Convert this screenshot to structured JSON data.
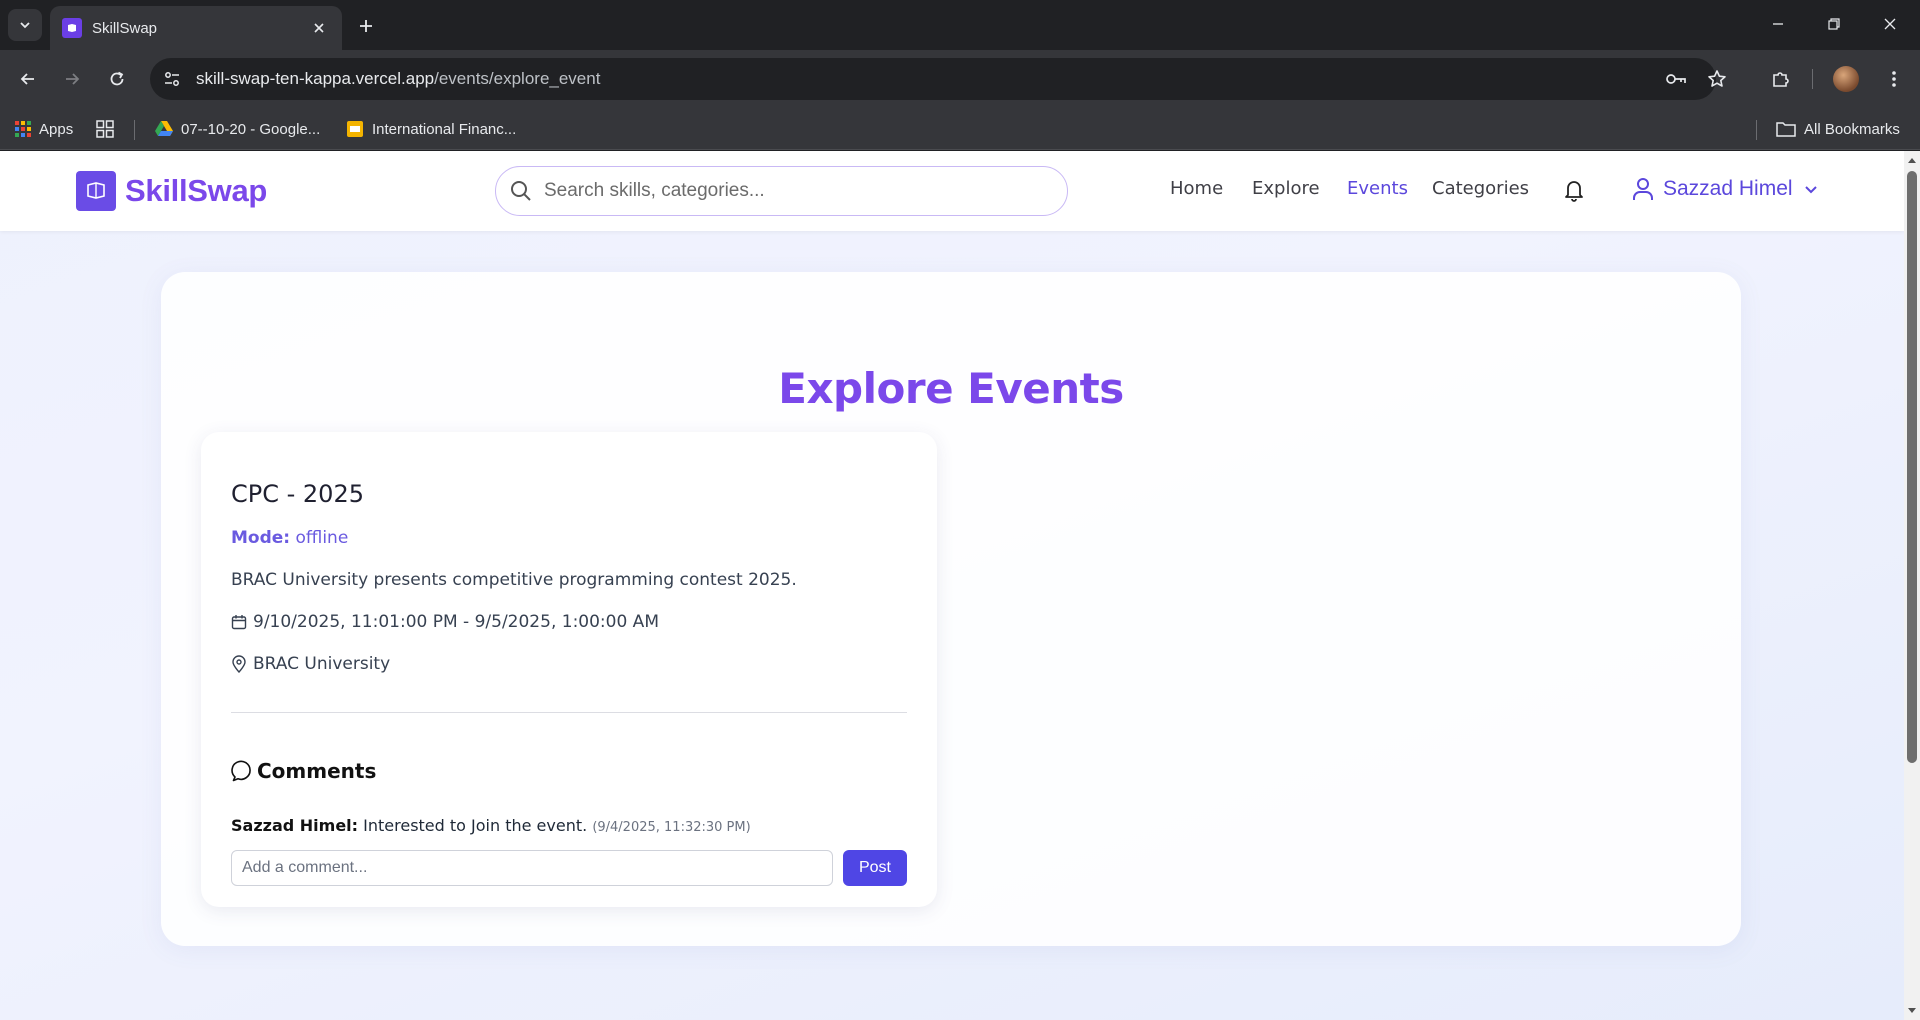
{
  "browser": {
    "tab_title": "SkillSwap",
    "url_host": "skill-swap-ten-kappa.vercel.app",
    "url_path": "/events/explore_event",
    "bookmarks": [
      {
        "label": "Apps",
        "icon": "apps-grid-icon"
      },
      {
        "label": "07--10-20 - Google...",
        "icon": "google-drive-icon"
      },
      {
        "label": "International Financ...",
        "icon": "google-slides-icon"
      }
    ],
    "all_bookmarks_label": "All Bookmarks"
  },
  "site": {
    "brand": "SkillSwap",
    "brand_color": "#7b48ea",
    "search_placeholder": "Search skills, categories...",
    "nav": [
      {
        "label": "Home",
        "active": false
      },
      {
        "label": "Explore",
        "active": false
      },
      {
        "label": "Events",
        "active": true
      },
      {
        "label": "Categories",
        "active": false
      }
    ],
    "user_name": "Sazzad Himel",
    "accent_color": "#5b47dc"
  },
  "page": {
    "title": "Explore Events"
  },
  "events": [
    {
      "title": "CPC - 2025",
      "mode_label": "Mode:",
      "mode_value": "offline",
      "description": "BRAC University presents competitive programming contest 2025.",
      "datetime": "9/10/2025, 11:01:00 PM - 9/5/2025, 1:00:00 AM",
      "location": "BRAC University",
      "comments_heading": "Comments",
      "comments": [
        {
          "author": "Sazzad Himel:",
          "text": "Interested to Join the event.",
          "timestamp": "(9/4/2025, 11:32:30 PM)"
        }
      ],
      "comment_placeholder": "Add a comment...",
      "post_label": "Post"
    }
  ]
}
